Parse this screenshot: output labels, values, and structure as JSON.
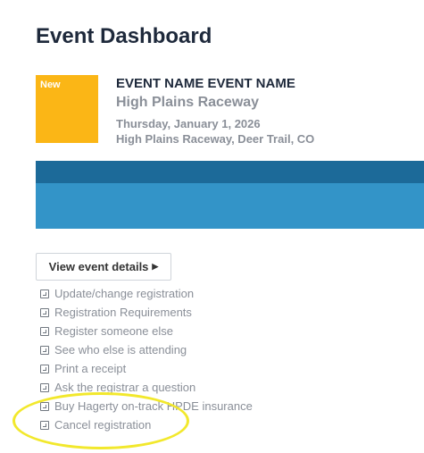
{
  "page": {
    "title": "Event Dashboard"
  },
  "event": {
    "badge": "New",
    "name": "EVENT NAME EVENT NAME",
    "venue": "High Plains Raceway",
    "date": "Thursday, January 1, 2026",
    "location": "High Plains Raceway, Deer Trail, CO",
    "thumbnail_color": "#fbb616"
  },
  "banner": {
    "colors": [
      "#1c6a99",
      "#3394c8"
    ]
  },
  "actions": {
    "view_details_label": "View event details",
    "view_details_icon": "caret-right-icon",
    "link_icon": "external-link-icon",
    "links": [
      "Update/change registration",
      "Registration Requirements",
      "Register someone else",
      "See who else is attending",
      "Print a receipt",
      "Ask the registrar a question",
      "Buy Hagerty on-track HPDE insurance",
      "Cancel registration"
    ]
  },
  "annotation": {
    "highlight_color": "#f2e82c",
    "highlighted_link": "Cancel registration"
  }
}
